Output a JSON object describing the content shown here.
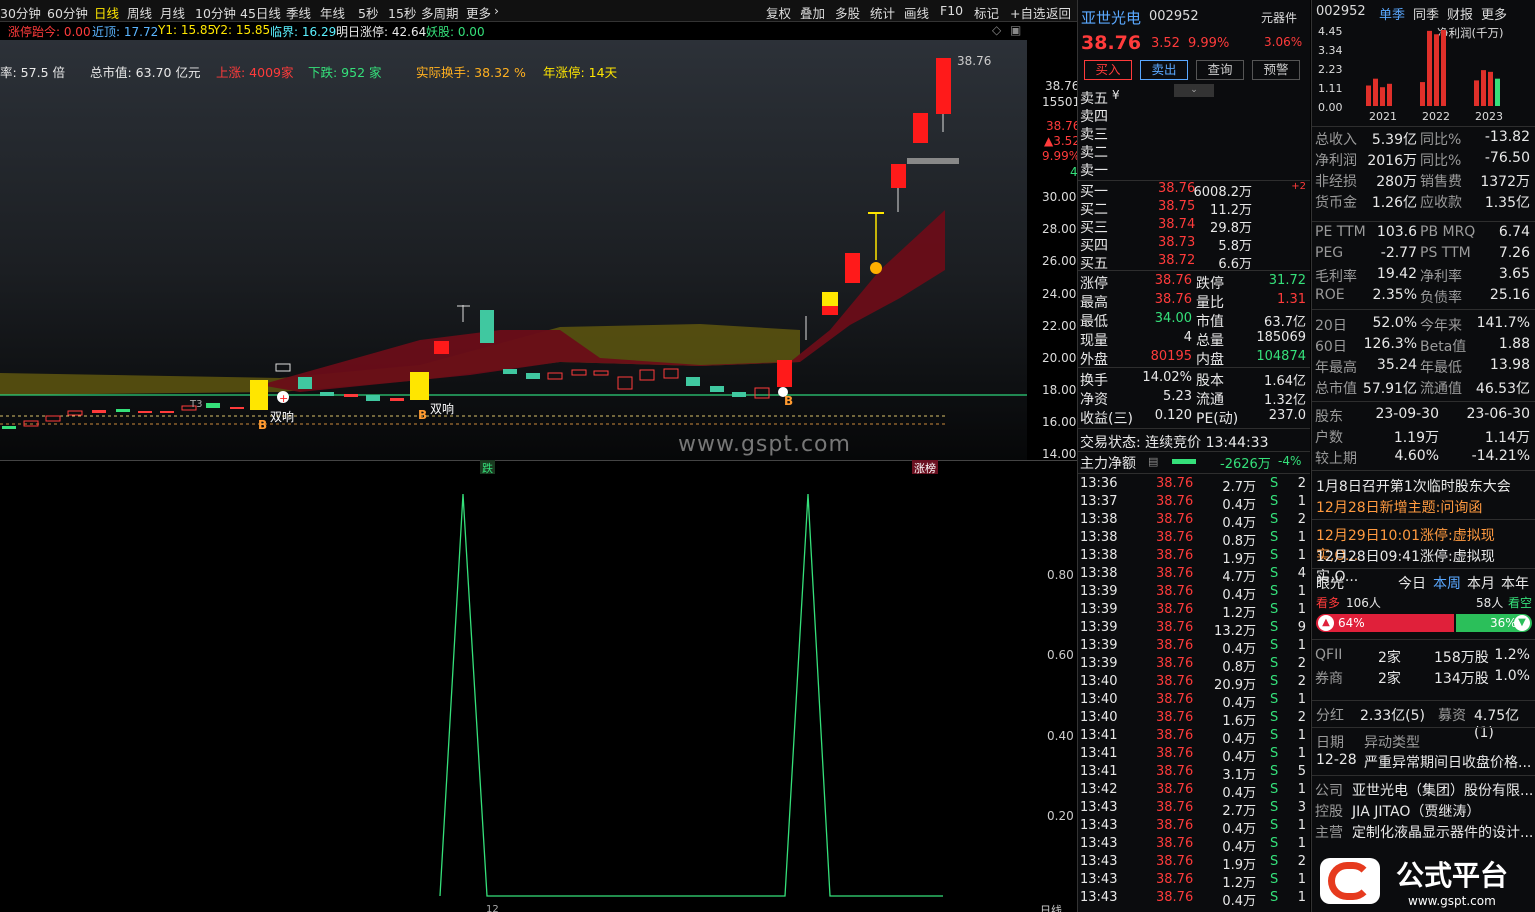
{
  "top_periods": [
    "30分钟",
    "60分钟",
    "日线",
    "周线",
    "月线",
    "10分钟",
    "45日线",
    "季线",
    "年线",
    "5秒",
    "15秒",
    "多周期",
    "更多"
  ],
  "top_active": "日线",
  "top_tools": [
    "复权",
    "叠加",
    "多股",
    "统计",
    "画线",
    "F10",
    "标记",
    "+自选",
    "返回"
  ],
  "info1": {
    "label": "涨停跆今: 0.00",
    "near": "近顶: 17.72",
    "y1": "Y1: 15.85",
    "y2": "Y2: 15.85",
    "critical": "临界: 16.29",
    "next_limit": "明日涨停: 42.64",
    "demon": "妖股: 0.00"
  },
  "info2": {
    "rate": "率:  57.5 倍",
    "mktcap": "总市值:  63.70 亿元",
    "up": "上涨: 4009家",
    "down": "下跌: 952 家",
    "turnover": "实际换手: 38.32 %",
    "limitdays": "年涨停: 14天"
  },
  "price_axis": [
    "30.00",
    "28.00",
    "26.00",
    "24.00",
    "22.00",
    "20.00",
    "18.00",
    "16.00",
    "14.00"
  ],
  "price_axis_top": {
    "last": "38.76",
    "vol": "15501",
    "p1": "38.76",
    "p2": "▲3.52",
    "p3": "9.99%",
    "p4": "4"
  },
  "chart_markers": {
    "high_label": "38.76",
    "double1": "双响",
    "double2": "双响",
    "b": "B",
    "t3": "T3"
  },
  "watermark": "www.gspt.com",
  "sep_labels": {
    "left": "跌",
    "right": "涨榜"
  },
  "sub_axis": [
    "0.80",
    "0.60",
    "0.40",
    "0.20"
  ],
  "sub_bottom_label": "12",
  "sub_axis_bottom": "日线",
  "stock": {
    "name": "亚世光电",
    "code": "002952",
    "tag": "元器件",
    "price": "38.76",
    "change": "3.52",
    "pct": "9.99%",
    "tag_pct": "3.06%",
    "buttons": [
      "买入",
      "卖出",
      "查询",
      "预警"
    ]
  },
  "asks": [
    {
      "label": "卖五",
      "extra": "¥"
    },
    {
      "label": "卖四",
      "extra": ""
    },
    {
      "label": "卖三",
      "extra": ""
    },
    {
      "label": "卖二",
      "extra": ""
    },
    {
      "label": "卖一",
      "extra": ""
    }
  ],
  "bids": [
    {
      "label": "买一",
      "price": "38.76",
      "vol": "6008.2万",
      "chg": "+2"
    },
    {
      "label": "买二",
      "price": "38.75",
      "vol": "11.2万",
      "chg": ""
    },
    {
      "label": "买三",
      "price": "38.74",
      "vol": "29.8万",
      "chg": ""
    },
    {
      "label": "买四",
      "price": "38.73",
      "vol": "5.8万",
      "chg": ""
    },
    {
      "label": "买五",
      "price": "38.72",
      "vol": "6.6万",
      "chg": ""
    }
  ],
  "quote": [
    {
      "l1": "涨停",
      "v1": "38.76",
      "l2": "跌停",
      "v2": "31.72"
    },
    {
      "l1": "最高",
      "v1": "38.76",
      "l2": "量比",
      "v2": "1.31"
    },
    {
      "l1": "最低",
      "v1": "34.00",
      "l2": "市值",
      "v2": "63.7亿"
    },
    {
      "l1": "现量",
      "v1": "4",
      "l2": "总量",
      "v2": "185069"
    },
    {
      "l1": "外盘",
      "v1": "80195",
      "l2": "内盘",
      "v2": "104874"
    }
  ],
  "quote2": [
    {
      "l1": "换手",
      "v1": "14.02%",
      "l2": "股本",
      "v2": "1.64亿"
    },
    {
      "l1": "净资",
      "v1": "5.23",
      "l2": "流通",
      "v2": "1.32亿"
    },
    {
      "l1": "收益(三)",
      "v1": "0.120",
      "l2": "PE(动)",
      "v2": "237.0"
    }
  ],
  "trade_state": "交易状态: 连续竞价  13:44:33",
  "main_net": {
    "label": "主力净额",
    "value": "-2626万",
    "pct": "-4%"
  },
  "ticks": [
    {
      "t": "13:36",
      "p": "38.76",
      "v": "2.7万",
      "s": "S",
      "n": "2"
    },
    {
      "t": "13:37",
      "p": "38.76",
      "v": "0.4万",
      "s": "S",
      "n": "1"
    },
    {
      "t": "13:38",
      "p": "38.76",
      "v": "0.4万",
      "s": "S",
      "n": "2"
    },
    {
      "t": "13:38",
      "p": "38.76",
      "v": "0.8万",
      "s": "S",
      "n": "1"
    },
    {
      "t": "13:38",
      "p": "38.76",
      "v": "1.9万",
      "s": "S",
      "n": "1"
    },
    {
      "t": "13:38",
      "p": "38.76",
      "v": "4.7万",
      "s": "S",
      "n": "4"
    },
    {
      "t": "13:39",
      "p": "38.76",
      "v": "0.4万",
      "s": "S",
      "n": "1"
    },
    {
      "t": "13:39",
      "p": "38.76",
      "v": "1.2万",
      "s": "S",
      "n": "1"
    },
    {
      "t": "13:39",
      "p": "38.76",
      "v": "13.2万",
      "s": "S",
      "n": "9"
    },
    {
      "t": "13:39",
      "p": "38.76",
      "v": "0.4万",
      "s": "S",
      "n": "1"
    },
    {
      "t": "13:39",
      "p": "38.76",
      "v": "0.8万",
      "s": "S",
      "n": "2"
    },
    {
      "t": "13:40",
      "p": "38.76",
      "v": "20.9万",
      "s": "S",
      "n": "2"
    },
    {
      "t": "13:40",
      "p": "38.76",
      "v": "0.4万",
      "s": "S",
      "n": "1"
    },
    {
      "t": "13:40",
      "p": "38.76",
      "v": "1.6万",
      "s": "S",
      "n": "2"
    },
    {
      "t": "13:41",
      "p": "38.76",
      "v": "0.4万",
      "s": "S",
      "n": "1"
    },
    {
      "t": "13:41",
      "p": "38.76",
      "v": "0.4万",
      "s": "S",
      "n": "1"
    },
    {
      "t": "13:41",
      "p": "38.76",
      "v": "3.1万",
      "s": "S",
      "n": "5"
    },
    {
      "t": "13:42",
      "p": "38.76",
      "v": "0.4万",
      "s": "S",
      "n": "1"
    },
    {
      "t": "13:43",
      "p": "38.76",
      "v": "2.7万",
      "s": "S",
      "n": "3"
    },
    {
      "t": "13:43",
      "p": "38.76",
      "v": "0.4万",
      "s": "S",
      "n": "1"
    },
    {
      "t": "13:43",
      "p": "38.76",
      "v": "0.4万",
      "s": "S",
      "n": "1"
    },
    {
      "t": "13:43",
      "p": "38.76",
      "v": "1.9万",
      "s": "S",
      "n": "2"
    },
    {
      "t": "13:43",
      "p": "38.76",
      "v": "1.2万",
      "s": "S",
      "n": "1"
    },
    {
      "t": "13:43",
      "p": "38.76",
      "v": "0.4万",
      "s": "S",
      "n": "1"
    }
  ],
  "fin_header": {
    "code": "002952",
    "tab1": "单季",
    "tab2": "同季",
    "tab3": "财报",
    "tab4": "更多",
    "unit": "净利润(千万)"
  },
  "fin_yaxis": [
    "4.45",
    "3.34",
    "2.23",
    "1.11",
    "0.00"
  ],
  "fin_years": [
    "2021",
    "2022",
    "2023"
  ],
  "fin_bars": [
    1.2,
    1.6,
    1.1,
    1.3,
    1.4,
    4.4,
    4.2,
    4.45,
    1.5,
    2.1,
    2.0,
    1.6
  ],
  "fin_rows": [
    {
      "l1": "总收入",
      "v1": "5.39亿",
      "l2": "同比%",
      "v2": "-13.82"
    },
    {
      "l1": "净利润",
      "v1": "2016万",
      "l2": "同比%",
      "v2": "-76.50"
    },
    {
      "l1": "非经损",
      "v1": "280万",
      "l2": "销售费",
      "v2": "1372万"
    },
    {
      "l1": "货币金",
      "v1": "1.26亿",
      "l2": "应收款",
      "v2": "1.35亿"
    }
  ],
  "val_rows": [
    {
      "l1": "PE TTM",
      "v1": "103.6",
      "l2": "PB MRQ",
      "v2": "6.74"
    },
    {
      "l1": "PEG",
      "v1": "-2.77",
      "l2": "PS TTM",
      "v2": "7.26"
    },
    {
      "l1": "毛利率",
      "v1": "19.42",
      "l2": "净利率",
      "v2": "3.65"
    },
    {
      "l1": "ROE",
      "v1": "2.35%",
      "l2": "负债率",
      "v2": "25.16"
    }
  ],
  "perf_rows": [
    {
      "l1": "20日",
      "v1": "52.0%",
      "l2": "今年来",
      "v2": "141.7%"
    },
    {
      "l1": "60日",
      "v1": "126.3%",
      "l2": "Beta值",
      "v2": "1.88"
    },
    {
      "l1": "年最高",
      "v1": "35.24",
      "l2": "年最低",
      "v2": "13.98"
    },
    {
      "l1": "总市值",
      "v1": "57.91亿",
      "l2": "流通值",
      "v2": "46.53亿"
    }
  ],
  "holder_rows": [
    {
      "l1": "股东",
      "v1": "23-09-30",
      "v2": "23-06-30"
    },
    {
      "l1": "户数",
      "v1": "1.19万",
      "v2": "1.14万"
    },
    {
      "l1": "较上期",
      "v1": "4.60%",
      "v2": "-14.21%"
    }
  ],
  "news": [
    "1月8日召开第1次临时股东大会",
    "12月28日新增主题:问询函",
    "12月29日10:01涨停:虚拟现实,O...",
    "12月28日09:41涨停:虚拟现实,O..."
  ],
  "vision": {
    "label": "眼光",
    "tab1": "今日",
    "tab2": "本周",
    "tab3": "本月",
    "tab4": "本年",
    "bull": "看多",
    "bull_n": "106人",
    "bear_n": "58人",
    "bear": "看空",
    "bull_pct": "64%",
    "bear_pct": "36%"
  },
  "inst": [
    {
      "l1": "QFII",
      "v1": "2家",
      "v2": "158万股",
      "v3": "1.2%"
    },
    {
      "l1": "券商",
      "v1": "2家",
      "v2": "134万股",
      "v3": "1.0%"
    }
  ],
  "dividend": {
    "l1": "分红",
    "v1": "2.33亿(5)",
    "l2": "募资",
    "v2": "4.75亿(1)"
  },
  "anomaly": {
    "l1": "日期",
    "v1": "异动类型",
    "date": "12-28",
    "desc": "严重异常期间日收盘价格..."
  },
  "company": [
    {
      "l": "公司",
      "v": "亚世光电（集团）股份有限..."
    },
    {
      "l": "控股",
      "v": "JIA JITAO（贾继涛）"
    },
    {
      "l": "主营",
      "v": "定制化液晶显示器件的设计..."
    }
  ],
  "logo_text": "公式平台",
  "logo_url": "www.gspt.com",
  "colors": {
    "up": "#ff3b3b",
    "down": "#35e07a",
    "accent": "#ffe600"
  },
  "chart_data": {
    "type": "line",
    "title": "",
    "x": [
      0,
      1,
      2,
      3,
      4,
      5,
      6,
      7,
      8,
      9,
      10,
      11,
      12,
      13,
      14,
      15,
      16,
      17,
      18,
      19
    ],
    "series": [
      {
        "values": [
          0,
          0,
          0,
          0,
          0,
          0,
          0,
          0,
          0,
          1,
          0,
          0,
          0,
          0,
          0,
          0,
          0,
          0,
          1,
          0
        ]
      }
    ],
    "ylim": [
      0,
      1
    ]
  }
}
